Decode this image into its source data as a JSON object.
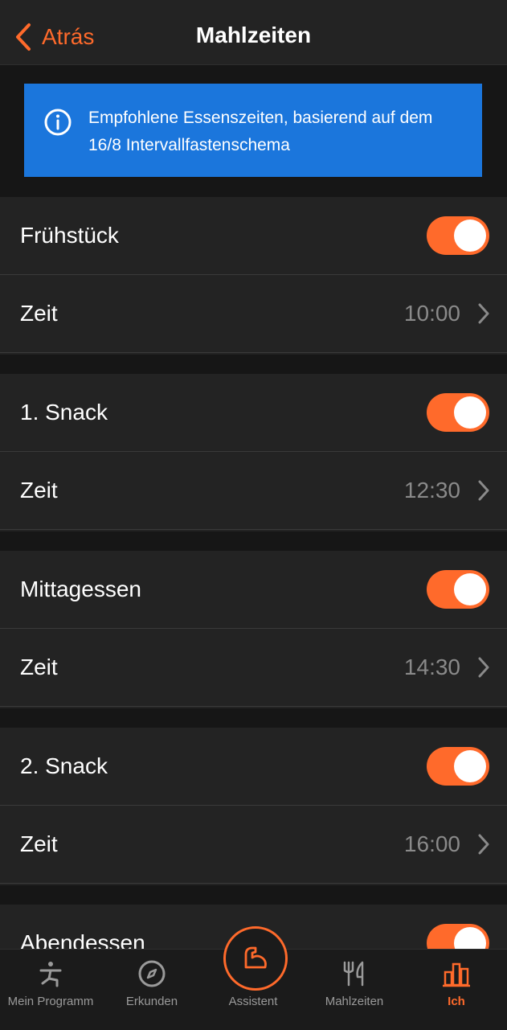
{
  "nav": {
    "back_label": "Atrás",
    "title": "Mahlzeiten"
  },
  "banner": {
    "text": "Empfohlene Essenszeiten, basierend auf dem 16/8 Intervallfastenschema"
  },
  "meals": [
    {
      "name": "Frühstück",
      "enabled": true,
      "time_label": "Zeit",
      "time": "10:00"
    },
    {
      "name": "1. Snack",
      "enabled": true,
      "time_label": "Zeit",
      "time": "12:30"
    },
    {
      "name": "Mittagessen",
      "enabled": true,
      "time_label": "Zeit",
      "time": "14:30"
    },
    {
      "name": "2. Snack",
      "enabled": true,
      "time_label": "Zeit",
      "time": "16:00"
    },
    {
      "name": "Abendessen",
      "enabled": true
    }
  ],
  "tabbar": {
    "items": [
      {
        "label": "Mein Programm",
        "icon": "figure-icon"
      },
      {
        "label": "Erkunden",
        "icon": "compass-icon"
      },
      {
        "label": "Assistent",
        "icon": "muscle-icon"
      },
      {
        "label": "Mahlzeiten",
        "icon": "fork-knife-icon"
      },
      {
        "label": "Ich",
        "icon": "bar-chart-icon",
        "active": true
      }
    ]
  },
  "colors": {
    "accent": "#ff6a2b",
    "banner": "#1b76dc",
    "background": "#161616",
    "row": "#232323"
  }
}
